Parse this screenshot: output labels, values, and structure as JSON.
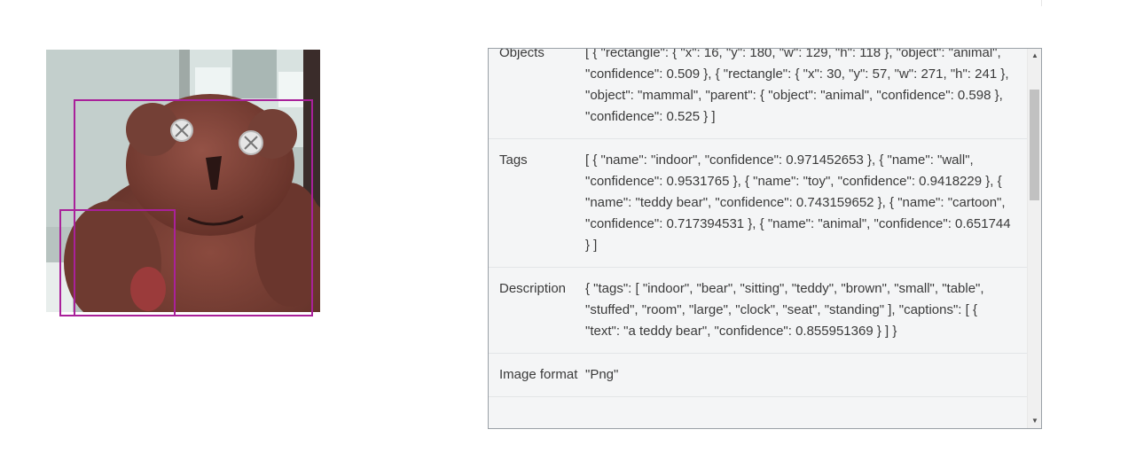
{
  "image": {
    "detections": [
      {
        "label": "mammal"
      },
      {
        "label": "animal"
      }
    ]
  },
  "results": {
    "rows": [
      {
        "key": "Objects",
        "value": "[ { \"rectangle\": { \"x\": 16, \"y\": 180, \"w\": 129, \"h\": 118 }, \"object\": \"animal\", \"confidence\": 0.509 }, { \"rectangle\": { \"x\": 30, \"y\": 57, \"w\": 271, \"h\": 241 }, \"object\": \"mammal\", \"parent\": { \"object\": \"animal\", \"confidence\": 0.598 }, \"confidence\": 0.525 } ]"
      },
      {
        "key": "Tags",
        "value": "[ { \"name\": \"indoor\", \"confidence\": 0.971452653 }, { \"name\": \"wall\", \"confidence\": 0.9531765 }, { \"name\": \"toy\", \"confidence\": 0.9418229 }, { \"name\": \"teddy bear\", \"confidence\": 0.743159652 }, { \"name\": \"cartoon\", \"confidence\": 0.717394531 }, { \"name\": \"animal\", \"confidence\": 0.651744 } ]"
      },
      {
        "key": "Description",
        "value": "{ \"tags\": [ \"indoor\", \"bear\", \"sitting\", \"teddy\", \"brown\", \"small\", \"table\", \"stuffed\", \"room\", \"large\", \"clock\", \"seat\", \"standing\" ], \"captions\": [ { \"text\": \"a teddy bear\", \"confidence\": 0.855951369 } ] }"
      },
      {
        "key": "Image format",
        "value": "\"Png\""
      },
      {
        "key": "",
        "value": ""
      }
    ]
  },
  "scrollbar": {
    "up_icon": "triangle-up",
    "down_icon": "triangle-down",
    "position": 0.12
  }
}
